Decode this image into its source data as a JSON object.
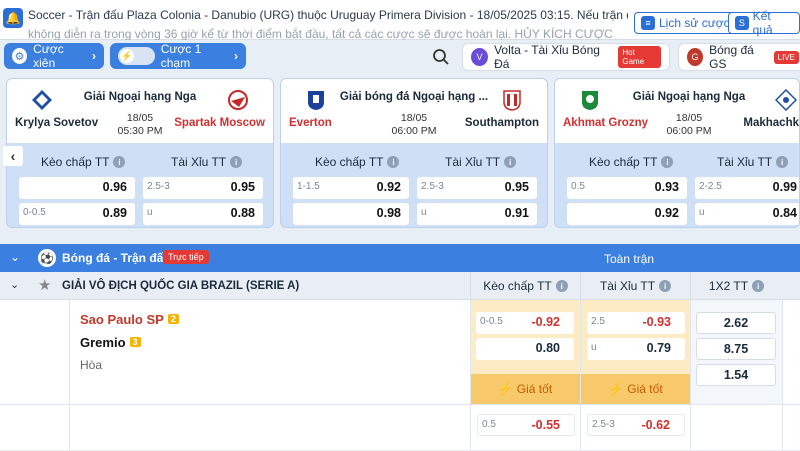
{
  "ticker": {
    "line1": "Soccer - Trận đấu Plaza Colonia - Danubio (URG) thuộc Uruguay Primera Division - 18/05/2025 03:15. Nếu trận đấu",
    "line2": "không diễn ra trong vòng 36 giờ kể từ thời điểm bắt đầu, tất cả các cược sẽ được hoàn lại. HỦY KÍCH CƯỢC"
  },
  "top_buttons": {
    "history": "Lịch sử cược",
    "result": "Kết quả"
  },
  "toolbar": {
    "parlay": "Cược xiên",
    "one_click": "Cược 1 chạm",
    "shortcut1": "Volta - Tài Xỉu Bóng Đá",
    "shortcut1_badge": "Hot Game",
    "shortcut2": "Bóng đá GS",
    "shortcut2_badge": "LIVE"
  },
  "cards": [
    {
      "league": "Giải Ngoại hạng Nga",
      "home": "Krylya Sovetov",
      "away": "Spartak Moscow",
      "date": "18/05",
      "time": "05:30 PM",
      "handicap_label": "Kèo chấp TT",
      "ou_label": "Tài Xỉu TT",
      "h_row1": {
        "line": "",
        "odd": "0.96"
      },
      "h_row2": {
        "line": "0-0.5",
        "odd": "0.89"
      },
      "ou_row1": {
        "line": "2.5-3",
        "odd": "0.95"
      },
      "ou_row2": {
        "line": "u",
        "odd": "0.88"
      }
    },
    {
      "league": "Giải bóng đá Ngoại hạng ...",
      "home": "Everton",
      "away": "Southampton",
      "date": "18/05",
      "time": "06:00 PM",
      "handicap_label": "Kèo chấp TT",
      "ou_label": "Tài Xỉu TT",
      "h_row1": {
        "line": "1-1.5",
        "odd": "0.92"
      },
      "h_row2": {
        "line": "",
        "odd": "0.98"
      },
      "ou_row1": {
        "line": "2.5-3",
        "odd": "0.95"
      },
      "ou_row2": {
        "line": "u",
        "odd": "0.91"
      }
    },
    {
      "league": "Giải Ngoại hạng Nga",
      "home": "Akhmat Grozny",
      "away": "Makhachk",
      "date": "18/05",
      "time": "06:00 PM",
      "handicap_label": "Kèo chấp TT",
      "ou_label": "Tài Xỉu TT",
      "h_row1": {
        "line": "0.5",
        "odd": "0.93"
      },
      "h_row2": {
        "line": "",
        "odd": "0.92"
      },
      "ou_row1": {
        "line": "2-2.5",
        "odd": "0.99"
      },
      "ou_row2": {
        "line": "u",
        "odd": "0.84"
      }
    }
  ],
  "section": {
    "title": "Bóng đá - Trận đấu",
    "live": "Trực tiếp",
    "full_match": "Toàn trận"
  },
  "league": {
    "name": "GIẢI VÔ ĐỊCH QUỐC GIA BRAZIL (SERIE A)",
    "col_handicap": "Kèo chấp TT",
    "col_ou": "Tài Xỉu TT",
    "col_1x2": "1X2 TT"
  },
  "match": {
    "home": "Sao Paulo SP",
    "home_badge": "2",
    "away": "Gremio",
    "away_badge": "3",
    "draw": "Hòa",
    "h1_line": "0-0.5",
    "h1_odd": "-0.92",
    "h2_odd": "0.80",
    "ou1_line": "2.5",
    "ou1_odd": "-0.93",
    "ou2_line": "u",
    "ou2_odd": "0.79",
    "best": "Giá tốt",
    "x1": "2.62",
    "x2": "8.75",
    "x3": "1.54"
  },
  "row2": {
    "h_line": "0.5",
    "h_odd": "-0.55",
    "ou_line": "2.5-3",
    "ou_odd": "-0.62"
  }
}
